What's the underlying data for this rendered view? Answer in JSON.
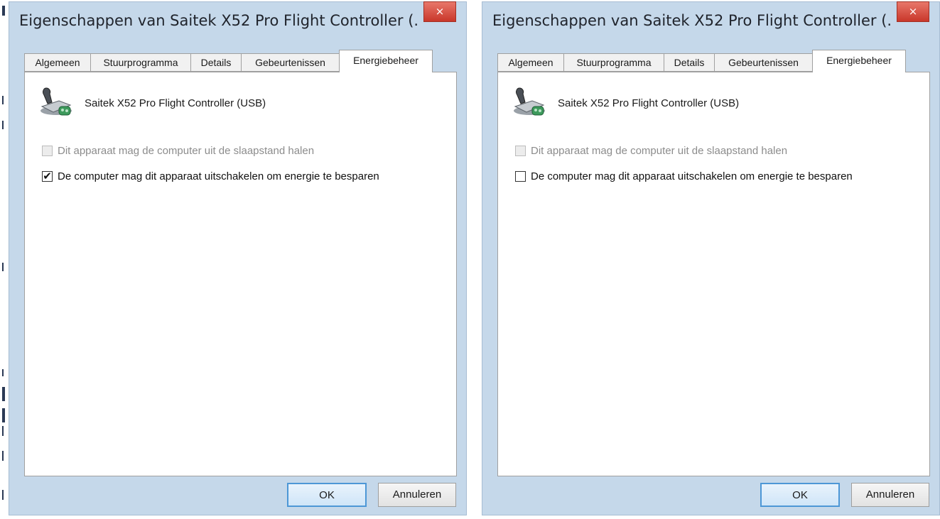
{
  "dialogs": [
    {
      "title": "Eigenschappen van Saitek X52 Pro Flight Controller (...",
      "close_glyph": "×",
      "tabs": [
        {
          "label": "Algemeen",
          "active": false
        },
        {
          "label": "Stuurprogramma",
          "active": false
        },
        {
          "label": "Details",
          "active": false
        },
        {
          "label": "Gebeurtenissen",
          "active": false
        },
        {
          "label": "Energiebeheer",
          "active": true
        }
      ],
      "device_icon": "joystick-icon",
      "device_name": "Saitek X52 Pro Flight Controller (USB)",
      "options": [
        {
          "label": "Dit apparaat mag de computer uit de slaapstand halen",
          "checked": false,
          "enabled": false
        },
        {
          "label": "De computer mag dit apparaat uitschakelen om energie te besparen",
          "checked": true,
          "enabled": true
        }
      ],
      "buttons": {
        "ok": "OK",
        "cancel": "Annuleren"
      }
    },
    {
      "title": "Eigenschappen van Saitek X52 Pro Flight Controller (...",
      "close_glyph": "×",
      "tabs": [
        {
          "label": "Algemeen",
          "active": false
        },
        {
          "label": "Stuurprogramma",
          "active": false
        },
        {
          "label": "Details",
          "active": false
        },
        {
          "label": "Gebeurtenissen",
          "active": false
        },
        {
          "label": "Energiebeheer",
          "active": true
        }
      ],
      "device_icon": "joystick-icon",
      "device_name": "Saitek X52 Pro Flight Controller (USB)",
      "options": [
        {
          "label": "Dit apparaat mag de computer uit de slaapstand halen",
          "checked": false,
          "enabled": false
        },
        {
          "label": "De computer mag dit apparaat uitschakelen om energie te besparen",
          "checked": false,
          "enabled": true
        }
      ],
      "buttons": {
        "ok": "OK",
        "cancel": "Annuleren"
      }
    }
  ],
  "colors": {
    "frame": "#c5d8ea",
    "close_button": "#c9372a",
    "default_button_border": "#4d97d6",
    "disabled_text": "#8c8c8c"
  }
}
